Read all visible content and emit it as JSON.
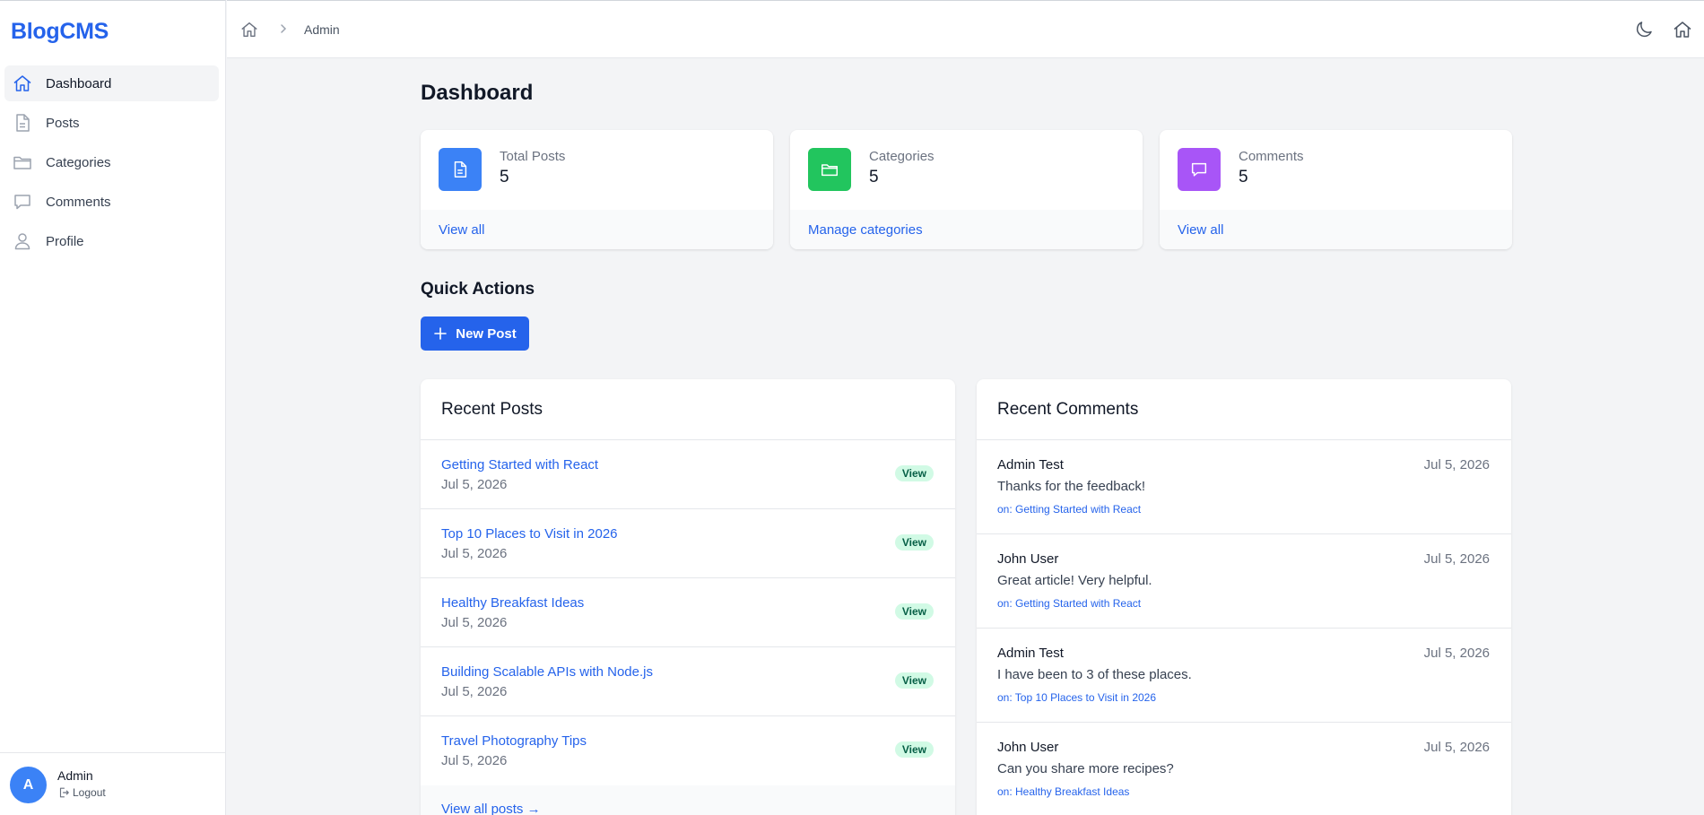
{
  "brand": "BlogCMS",
  "sidebar": {
    "items": [
      {
        "label": "Dashboard",
        "icon": "home-icon",
        "active": true
      },
      {
        "label": "Posts",
        "icon": "document-icon"
      },
      {
        "label": "Categories",
        "icon": "folder-icon"
      },
      {
        "label": "Comments",
        "icon": "chat-icon"
      },
      {
        "label": "Profile",
        "icon": "user-icon"
      }
    ],
    "user": {
      "initial": "A",
      "name": "Admin",
      "logout_label": "Logout"
    }
  },
  "topbar": {
    "breadcrumb": {
      "current": "Admin"
    },
    "icons": [
      "moon-icon",
      "home-icon"
    ]
  },
  "main": {
    "title": "Dashboard",
    "stats": [
      {
        "label": "Total Posts",
        "value": "5",
        "link": "View all",
        "color": "#3b82f6",
        "icon": "document-icon"
      },
      {
        "label": "Categories",
        "value": "5",
        "link": "Manage categories",
        "color": "#22c55e",
        "icon": "folder-icon"
      },
      {
        "label": "Comments",
        "value": "5",
        "link": "View all",
        "color": "#a855f7",
        "icon": "chat-icon"
      }
    ],
    "quick_actions": {
      "title": "Quick Actions",
      "new_post_label": "New Post"
    },
    "recent_posts": {
      "title": "Recent Posts",
      "badge_label": "View",
      "items": [
        {
          "title": "Getting Started with React",
          "date": "Jul 5, 2026"
        },
        {
          "title": "Top 10 Places to Visit in 2026",
          "date": "Jul 5, 2026"
        },
        {
          "title": "Healthy Breakfast Ideas",
          "date": "Jul 5, 2026"
        },
        {
          "title": "Building Scalable APIs with Node.js",
          "date": "Jul 5, 2026"
        },
        {
          "title": "Travel Photography Tips",
          "date": "Jul 5, 2026"
        }
      ],
      "footer_link": "View all posts →"
    },
    "recent_comments": {
      "title": "Recent Comments",
      "items": [
        {
          "author": "Admin Test",
          "date": "Jul 5, 2026",
          "text": "Thanks for the feedback!",
          "on": "on: Getting Started with React"
        },
        {
          "author": "John User",
          "date": "Jul 5, 2026",
          "text": "Great article! Very helpful.",
          "on": "on: Getting Started with React"
        },
        {
          "author": "Admin Test",
          "date": "Jul 5, 2026",
          "text": "I have been to 3 of these places.",
          "on": "on: Top 10 Places to Visit in 2026"
        },
        {
          "author": "John User",
          "date": "Jul 5, 2026",
          "text": "Can you share more recipes?",
          "on": "on: Healthy Breakfast Ideas"
        }
      ]
    }
  }
}
